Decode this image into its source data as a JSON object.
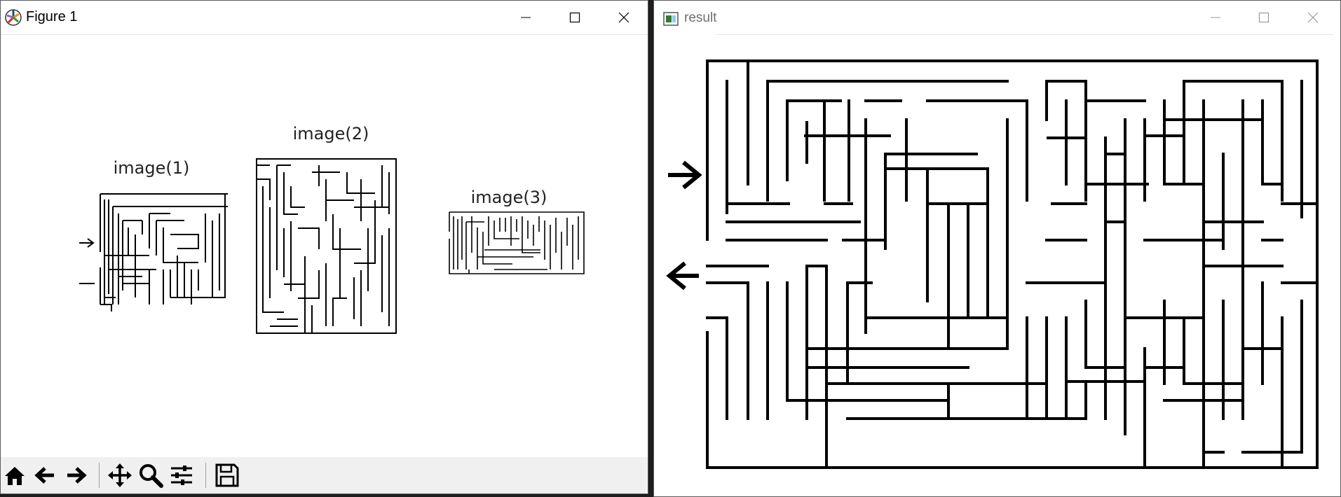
{
  "figure_window": {
    "title": "Figure 1",
    "icon": "matplotlib-icon",
    "controls": [
      "minimize-icon",
      "maximize-icon",
      "close-icon"
    ],
    "subplots": [
      {
        "title": "image(1)"
      },
      {
        "title": "image(2)"
      },
      {
        "title": "image(3)"
      }
    ],
    "toolbar": [
      {
        "icon": "home-icon"
      },
      {
        "icon": "back-arrow-icon"
      },
      {
        "icon": "forward-arrow-icon"
      },
      {
        "icon": "pan-icon"
      },
      {
        "icon": "zoom-icon"
      },
      {
        "icon": "configure-subplots-icon"
      },
      {
        "icon": "save-icon"
      }
    ]
  },
  "result_window": {
    "title": "result",
    "icon": "opencv-window-icon",
    "controls": [
      "minimize-icon",
      "maximize-icon",
      "close-icon"
    ]
  },
  "colors": {
    "maze_line": "#000000",
    "background": "#ffffff",
    "toolbar_bg": "#f0f0f0"
  }
}
